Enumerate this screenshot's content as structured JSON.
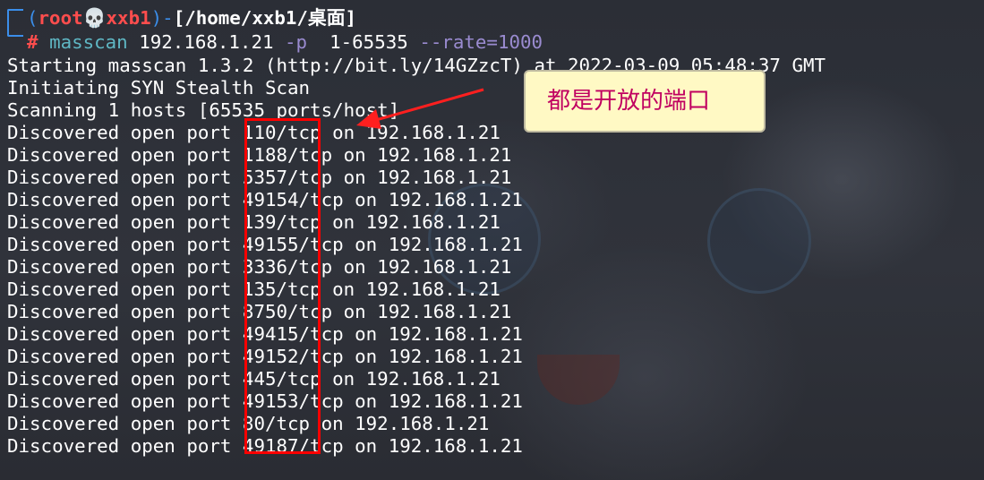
{
  "prompt": {
    "open_paren": "(",
    "user": "root",
    "skull": "💀",
    "host": "xxb1",
    "close_paren": ")",
    "dash": "-",
    "path": "[/home/xxb1/桌面]",
    "hash": "#",
    "command": "masscan",
    "ip": "192.168.1.21",
    "port_flag": "-p",
    "port_range": "1-65535",
    "rate": "--rate=1000"
  },
  "output": {
    "starting": "Starting masscan 1.3.2 (http://bit.ly/14GZzcT) at 2022-03-09 05:48:37 GMT",
    "initiating": "Initiating SYN Stealth Scan",
    "scanning": "Scanning 1 hosts [65535 ports/host]"
  },
  "discovered": [
    "Discovered open port 110/tcp on 192.168.1.21",
    "Discovered open port 1188/tcp on 192.168.1.21",
    "Discovered open port 5357/tcp on 192.168.1.21",
    "Discovered open port 49154/tcp on 192.168.1.21",
    "Discovered open port 139/tcp on 192.168.1.21",
    "Discovered open port 49155/tcp on 192.168.1.21",
    "Discovered open port 3336/tcp on 192.168.1.21",
    "Discovered open port 135/tcp on 192.168.1.21",
    "Discovered open port 8750/tcp on 192.168.1.21",
    "Discovered open port 49415/tcp on 192.168.1.21",
    "Discovered open port 49152/tcp on 192.168.1.21",
    "Discovered open port 445/tcp on 192.168.1.21",
    "Discovered open port 49153/tcp on 192.168.1.21",
    "Discovered open port 80/tcp on 192.168.1.21",
    "Discovered open port 49187/tcp on 192.168.1.21"
  ],
  "annotation": {
    "text": "都是开放的端口"
  },
  "colors": {
    "terminal_bg": "#2b2e36",
    "prompt_frame": "#3b8eea",
    "user_host": "#ff4d4d",
    "command": "#5fb7c4",
    "flag": "#9a8bd0",
    "highlight_box": "#ff0000",
    "callout_bg": "#fff9c4",
    "callout_text": "#c00060"
  },
  "icons": {
    "skull": "skull-icon",
    "arrow": "arrow-icon"
  }
}
